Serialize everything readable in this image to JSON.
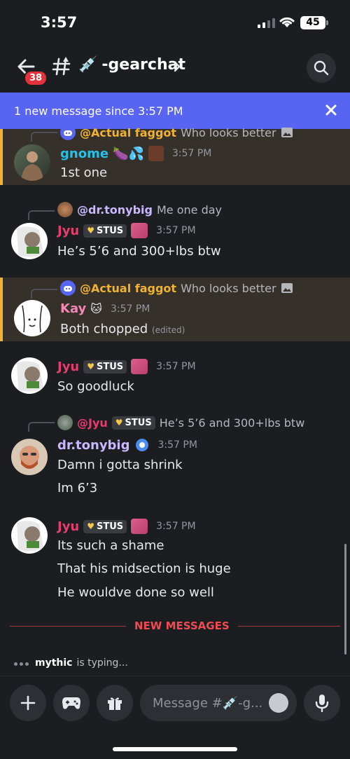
{
  "status_bar": {
    "time": "3:57",
    "battery": "45"
  },
  "header": {
    "badge": "38",
    "channel_name": "-gearchat",
    "channel_emoji": "💉"
  },
  "banner": {
    "text": "1 new message since 3:57 PM"
  },
  "messages": [
    {
      "reply_author": "@Actual faggot",
      "reply_text": "Who looks better",
      "author": "gnome",
      "author_emojis": "🍆💦",
      "time": "3:57 PM",
      "lines": [
        "1st one"
      ],
      "author_color": "#28c0e6"
    },
    {
      "reply_author": "@dr.tonybig",
      "reply_text": "Me one day",
      "author": "Jyu",
      "tag": "STUS",
      "time": "3:57 PM",
      "lines": [
        "He’s 5’6 and 300+lbs btw"
      ],
      "author_color": "#e93c6e"
    },
    {
      "reply_author": "@Actual faggot",
      "reply_text": "Who looks better",
      "author": "Kay",
      "author_emojis": "🐱",
      "time": "3:57 PM",
      "lines": [
        "Both chopped"
      ],
      "edited": "(edited)",
      "author_color": "#f287b5"
    },
    {
      "author": "Jyu",
      "tag": "STUS",
      "time": "3:57 PM",
      "lines": [
        "So goodluck"
      ],
      "author_color": "#e93c6e"
    },
    {
      "reply_author": "@Jyu",
      "reply_tag": "STUS",
      "reply_text": "He’s 5’6 and 300+lbs btw",
      "author": "dr.tonybig",
      "time": "3:57 PM",
      "lines": [
        "Damn i gotta shrink",
        "Im 6’3"
      ],
      "author_color": "#c9b8ff"
    },
    {
      "author": "Jyu",
      "tag": "STUS",
      "time": "3:57 PM",
      "lines": [
        "Its such a shame",
        "That his midsection is huge",
        "He wouldve done so well"
      ],
      "author_color": "#e93c6e"
    }
  ],
  "divider": {
    "label": "NEW MESSAGES"
  },
  "typing": {
    "user": "mythic",
    "text": "is typing..."
  },
  "composer": {
    "placeholder": "Message #💉-g..."
  },
  "colors": {
    "accent": "#5865f2",
    "mention_bar": "#f0b232",
    "new_messages": "#f04b53"
  }
}
